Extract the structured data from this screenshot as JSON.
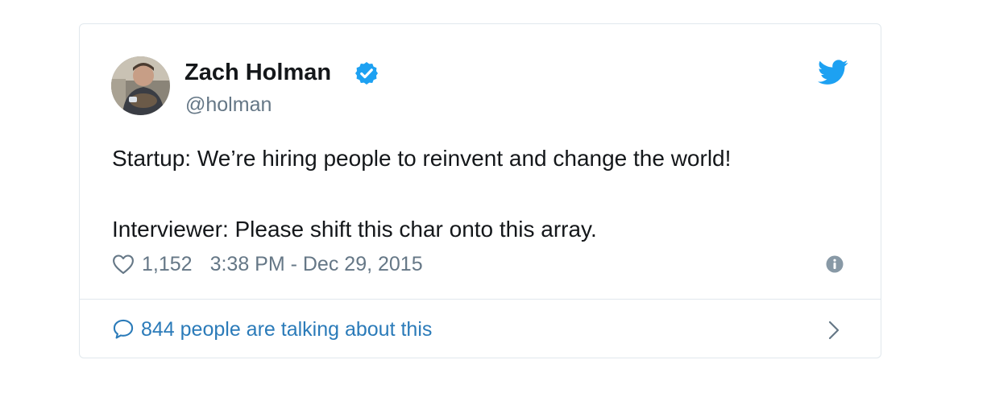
{
  "tweet": {
    "author": {
      "display_name": "Zach Holman",
      "handle": "@holman",
      "verified": true
    },
    "text_lines": [
      "Startup: We’re hiring people to reinvent and change the world!",
      "Interviewer: Please shift this char onto this array."
    ],
    "likes": "1,152",
    "timestamp": "3:38 PM - Dec 29, 2015",
    "conversation_label": "844 people are talking about this"
  },
  "icons": {
    "verified": "verified-badge-icon",
    "brand": "twitter-bird-icon",
    "like": "heart-icon",
    "info": "info-icon",
    "reply": "speech-bubble-icon",
    "more": "chevron-right-icon"
  },
  "colors": {
    "brand_blue": "#1da1f2",
    "link_blue": "#2b7bb9",
    "text": "#14171a",
    "muted": "#657786",
    "border": "#e1e8ed"
  }
}
